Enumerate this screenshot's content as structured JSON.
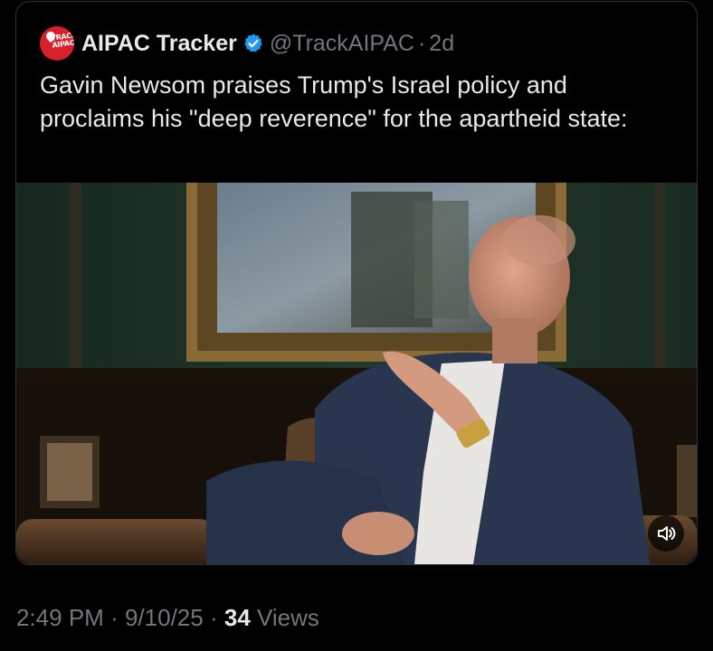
{
  "quote": {
    "display_name": "AIPAC Tracker",
    "avatar_text_line1": "TRACK",
    "avatar_text_line2": "AIPAC",
    "handle": "@TrackAIPAC",
    "separator": "·",
    "time_ago": "2d",
    "text": "Gavin Newsom praises Trump's Israel policy and proclaims his \"deep reverence\" for the apartheid state:",
    "media": {
      "icon": "volume-icon"
    }
  },
  "meta": {
    "time": "2:49 PM",
    "sep1": "·",
    "date": "9/10/25",
    "sep2": "·",
    "views_count": "34",
    "views_label": "Views"
  },
  "colors": {
    "background": "#000000",
    "text_primary": "#e7e9ea",
    "text_secondary": "#71767b",
    "verified": "#1d9bf0",
    "avatar": "#d8202a"
  }
}
